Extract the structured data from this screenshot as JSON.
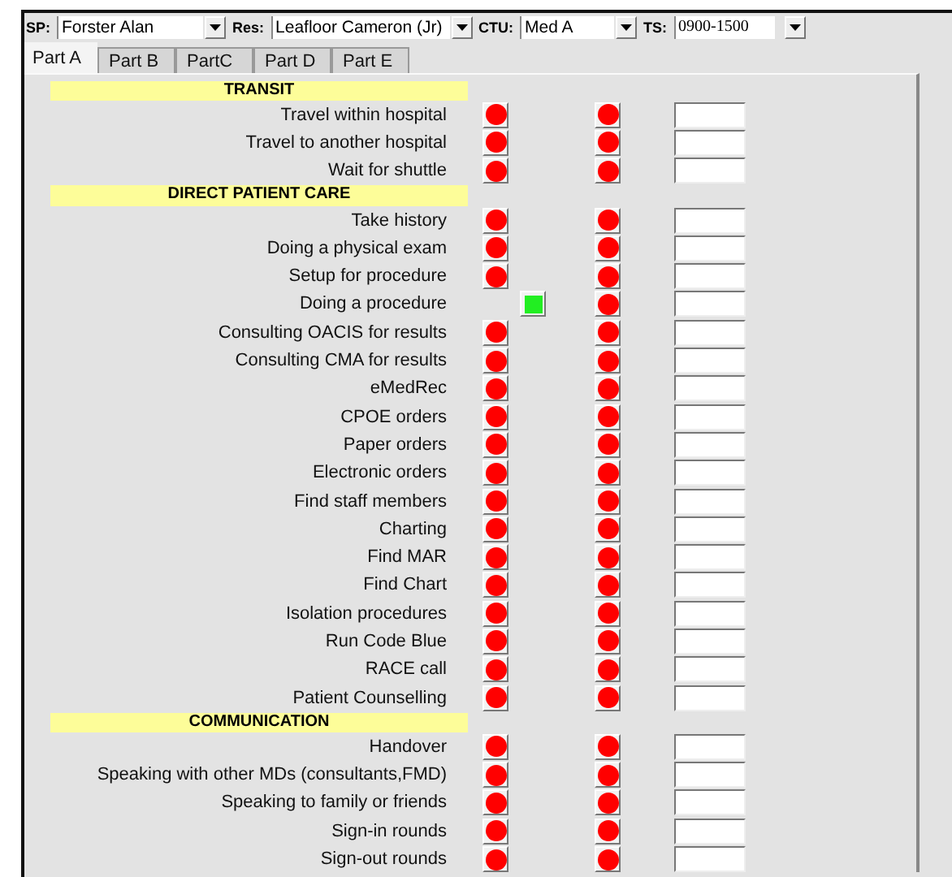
{
  "filters": [
    {
      "label": "SP:",
      "value": "Forster Alan"
    },
    {
      "label": "Res:",
      "value": "Leafloor Cameron (Jr)"
    },
    {
      "label": "CTU:",
      "value": "Med A"
    },
    {
      "label": "TS:",
      "value": "0900-1500"
    }
  ],
  "tabs": [
    {
      "label": "Part A",
      "selected": true
    },
    {
      "label": "Part B",
      "selected": false
    },
    {
      "label": "PartC",
      "selected": false
    },
    {
      "label": "Part D",
      "selected": false
    },
    {
      "label": "Part E",
      "selected": false
    }
  ],
  "sections": [
    {
      "title": "TRANSIT",
      "rows": [
        {
          "label": "Travel within hospital",
          "done": false
        },
        {
          "label": "Travel to another hospital",
          "done": false
        },
        {
          "label": "Wait for shuttle",
          "done": false
        }
      ]
    },
    {
      "title": "DIRECT PATIENT CARE",
      "rows": [
        {
          "label": "Take history",
          "done": false
        },
        {
          "label": "Doing a physical exam",
          "done": false
        },
        {
          "label": "Setup for procedure",
          "done": false
        },
        {
          "label": "Doing a procedure",
          "done": true
        },
        {
          "label": "Consulting OACIS for results",
          "done": false
        },
        {
          "label": "Consulting CMA for results",
          "done": false
        },
        {
          "label": "eMedRec",
          "done": false
        },
        {
          "label": "CPOE orders",
          "done": false
        },
        {
          "label": "Paper orders",
          "done": false
        },
        {
          "label": "Electronic orders",
          "done": false
        },
        {
          "label": "Find staff members",
          "done": false
        },
        {
          "label": "Charting",
          "done": false
        },
        {
          "label": "Find MAR",
          "done": false
        },
        {
          "label": "Find Chart",
          "done": false
        },
        {
          "label": "Isolation procedures",
          "done": false
        },
        {
          "label": "Run Code Blue",
          "done": false
        },
        {
          "label": "RACE call",
          "done": false
        },
        {
          "label": "Patient Counselling",
          "done": false
        }
      ]
    },
    {
      "title": "COMMUNICATION",
      "rows": [
        {
          "label": "Handover",
          "done": false
        },
        {
          "label": "Speaking with other MDs (consultants,FMD)",
          "done": false
        },
        {
          "label": "Speaking to family or friends",
          "done": false
        },
        {
          "label": "Sign-in rounds",
          "done": false
        },
        {
          "label": "Sign-out rounds",
          "done": false
        }
      ]
    }
  ]
}
